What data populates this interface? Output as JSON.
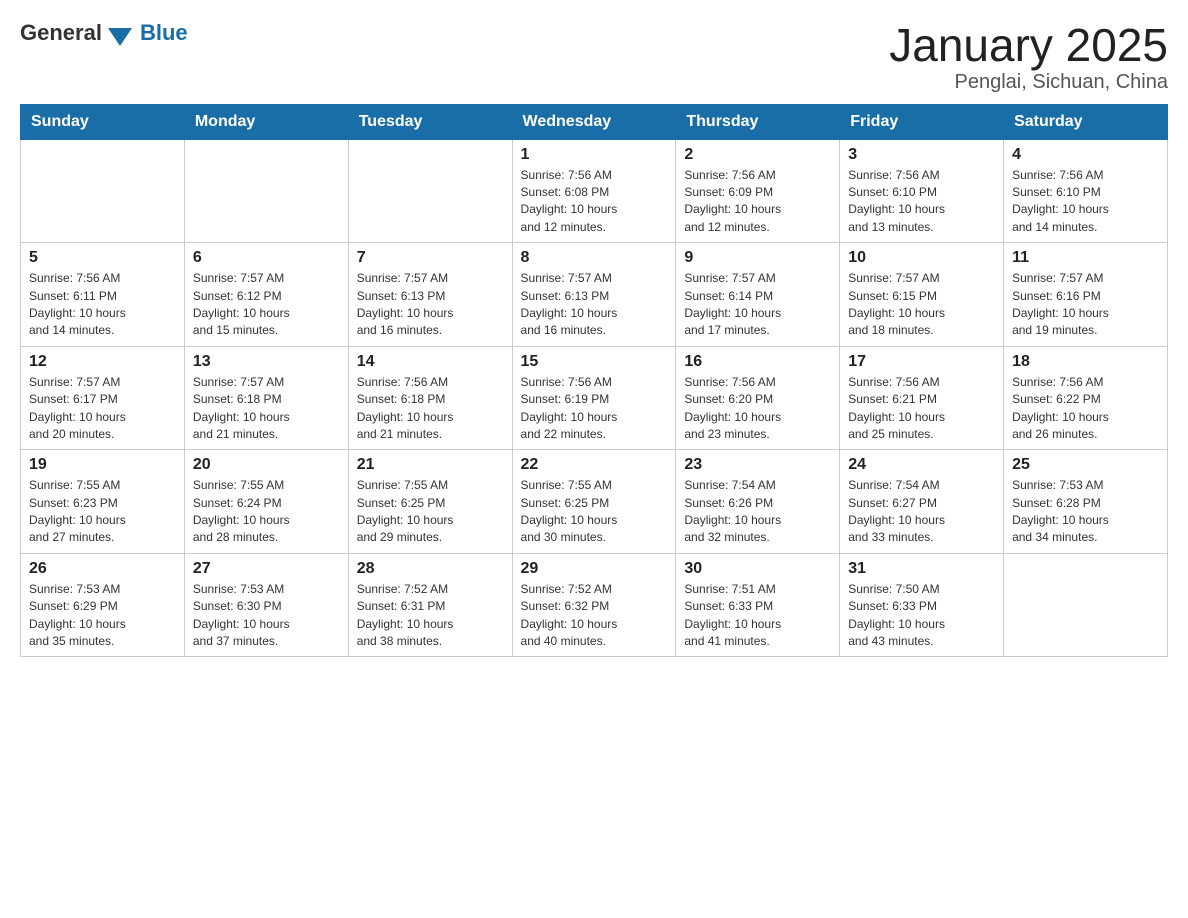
{
  "logo": {
    "general": "General",
    "blue": "Blue"
  },
  "title": "January 2025",
  "subtitle": "Penglai, Sichuan, China",
  "days_of_week": [
    "Sunday",
    "Monday",
    "Tuesday",
    "Wednesday",
    "Thursday",
    "Friday",
    "Saturday"
  ],
  "weeks": [
    [
      {
        "day": "",
        "info": ""
      },
      {
        "day": "",
        "info": ""
      },
      {
        "day": "",
        "info": ""
      },
      {
        "day": "1",
        "info": "Sunrise: 7:56 AM\nSunset: 6:08 PM\nDaylight: 10 hours\nand 12 minutes."
      },
      {
        "day": "2",
        "info": "Sunrise: 7:56 AM\nSunset: 6:09 PM\nDaylight: 10 hours\nand 12 minutes."
      },
      {
        "day": "3",
        "info": "Sunrise: 7:56 AM\nSunset: 6:10 PM\nDaylight: 10 hours\nand 13 minutes."
      },
      {
        "day": "4",
        "info": "Sunrise: 7:56 AM\nSunset: 6:10 PM\nDaylight: 10 hours\nand 14 minutes."
      }
    ],
    [
      {
        "day": "5",
        "info": "Sunrise: 7:56 AM\nSunset: 6:11 PM\nDaylight: 10 hours\nand 14 minutes."
      },
      {
        "day": "6",
        "info": "Sunrise: 7:57 AM\nSunset: 6:12 PM\nDaylight: 10 hours\nand 15 minutes."
      },
      {
        "day": "7",
        "info": "Sunrise: 7:57 AM\nSunset: 6:13 PM\nDaylight: 10 hours\nand 16 minutes."
      },
      {
        "day": "8",
        "info": "Sunrise: 7:57 AM\nSunset: 6:13 PM\nDaylight: 10 hours\nand 16 minutes."
      },
      {
        "day": "9",
        "info": "Sunrise: 7:57 AM\nSunset: 6:14 PM\nDaylight: 10 hours\nand 17 minutes."
      },
      {
        "day": "10",
        "info": "Sunrise: 7:57 AM\nSunset: 6:15 PM\nDaylight: 10 hours\nand 18 minutes."
      },
      {
        "day": "11",
        "info": "Sunrise: 7:57 AM\nSunset: 6:16 PM\nDaylight: 10 hours\nand 19 minutes."
      }
    ],
    [
      {
        "day": "12",
        "info": "Sunrise: 7:57 AM\nSunset: 6:17 PM\nDaylight: 10 hours\nand 20 minutes."
      },
      {
        "day": "13",
        "info": "Sunrise: 7:57 AM\nSunset: 6:18 PM\nDaylight: 10 hours\nand 21 minutes."
      },
      {
        "day": "14",
        "info": "Sunrise: 7:56 AM\nSunset: 6:18 PM\nDaylight: 10 hours\nand 21 minutes."
      },
      {
        "day": "15",
        "info": "Sunrise: 7:56 AM\nSunset: 6:19 PM\nDaylight: 10 hours\nand 22 minutes."
      },
      {
        "day": "16",
        "info": "Sunrise: 7:56 AM\nSunset: 6:20 PM\nDaylight: 10 hours\nand 23 minutes."
      },
      {
        "day": "17",
        "info": "Sunrise: 7:56 AM\nSunset: 6:21 PM\nDaylight: 10 hours\nand 25 minutes."
      },
      {
        "day": "18",
        "info": "Sunrise: 7:56 AM\nSunset: 6:22 PM\nDaylight: 10 hours\nand 26 minutes."
      }
    ],
    [
      {
        "day": "19",
        "info": "Sunrise: 7:55 AM\nSunset: 6:23 PM\nDaylight: 10 hours\nand 27 minutes."
      },
      {
        "day": "20",
        "info": "Sunrise: 7:55 AM\nSunset: 6:24 PM\nDaylight: 10 hours\nand 28 minutes."
      },
      {
        "day": "21",
        "info": "Sunrise: 7:55 AM\nSunset: 6:25 PM\nDaylight: 10 hours\nand 29 minutes."
      },
      {
        "day": "22",
        "info": "Sunrise: 7:55 AM\nSunset: 6:25 PM\nDaylight: 10 hours\nand 30 minutes."
      },
      {
        "day": "23",
        "info": "Sunrise: 7:54 AM\nSunset: 6:26 PM\nDaylight: 10 hours\nand 32 minutes."
      },
      {
        "day": "24",
        "info": "Sunrise: 7:54 AM\nSunset: 6:27 PM\nDaylight: 10 hours\nand 33 minutes."
      },
      {
        "day": "25",
        "info": "Sunrise: 7:53 AM\nSunset: 6:28 PM\nDaylight: 10 hours\nand 34 minutes."
      }
    ],
    [
      {
        "day": "26",
        "info": "Sunrise: 7:53 AM\nSunset: 6:29 PM\nDaylight: 10 hours\nand 35 minutes."
      },
      {
        "day": "27",
        "info": "Sunrise: 7:53 AM\nSunset: 6:30 PM\nDaylight: 10 hours\nand 37 minutes."
      },
      {
        "day": "28",
        "info": "Sunrise: 7:52 AM\nSunset: 6:31 PM\nDaylight: 10 hours\nand 38 minutes."
      },
      {
        "day": "29",
        "info": "Sunrise: 7:52 AM\nSunset: 6:32 PM\nDaylight: 10 hours\nand 40 minutes."
      },
      {
        "day": "30",
        "info": "Sunrise: 7:51 AM\nSunset: 6:33 PM\nDaylight: 10 hours\nand 41 minutes."
      },
      {
        "day": "31",
        "info": "Sunrise: 7:50 AM\nSunset: 6:33 PM\nDaylight: 10 hours\nand 43 minutes."
      },
      {
        "day": "",
        "info": ""
      }
    ]
  ]
}
